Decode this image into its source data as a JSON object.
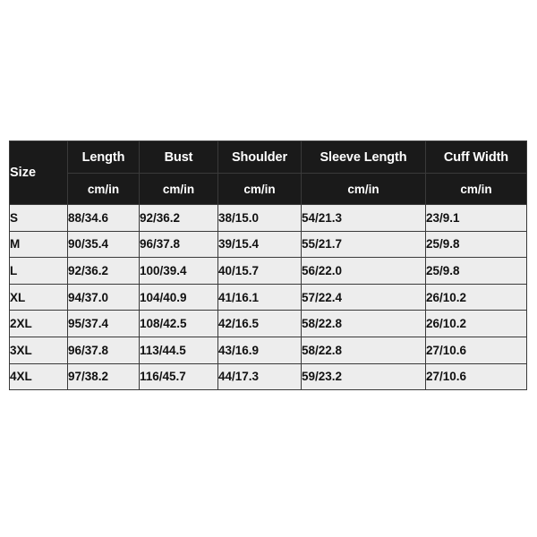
{
  "table": {
    "size_header_label": "Size",
    "unit_label": "cm/in",
    "columns": [
      {
        "key": "size",
        "label": "Size",
        "unit": ""
      },
      {
        "key": "length",
        "label": "Length",
        "unit": "cm/in"
      },
      {
        "key": "bust",
        "label": "Bust",
        "unit": "cm/in"
      },
      {
        "key": "shoulder",
        "label": "Shoulder",
        "unit": "cm/in"
      },
      {
        "key": "sleeve",
        "label": "Sleeve Length",
        "unit": "cm/in"
      },
      {
        "key": "cuff",
        "label": "Cuff Width",
        "unit": "cm/in"
      }
    ],
    "rows": [
      {
        "size": "S",
        "length": "88/34.6",
        "bust": "92/36.2",
        "shoulder": "38/15.0",
        "sleeve": "54/21.3",
        "cuff": "23/9.1"
      },
      {
        "size": "M",
        "length": "90/35.4",
        "bust": "96/37.8",
        "shoulder": "39/15.4",
        "sleeve": "55/21.7",
        "cuff": "25/9.8"
      },
      {
        "size": "L",
        "length": "92/36.2",
        "bust": "100/39.4",
        "shoulder": "40/15.7",
        "sleeve": "56/22.0",
        "cuff": "25/9.8"
      },
      {
        "size": "XL",
        "length": "94/37.0",
        "bust": "104/40.9",
        "shoulder": "41/16.1",
        "sleeve": "57/22.4",
        "cuff": "26/10.2"
      },
      {
        "size": "2XL",
        "length": "95/37.4",
        "bust": "108/42.5",
        "shoulder": "42/16.5",
        "sleeve": "58/22.8",
        "cuff": "26/10.2"
      },
      {
        "size": "3XL",
        "length": "96/37.8",
        "bust": "113/44.5",
        "shoulder": "43/16.9",
        "sleeve": "58/22.8",
        "cuff": "27/10.6"
      },
      {
        "size": "4XL",
        "length": "97/38.2",
        "bust": "116/45.7",
        "shoulder": "44/17.3",
        "sleeve": "59/23.2",
        "cuff": "27/10.6"
      }
    ]
  },
  "colors": {
    "header_background": "#1a1a1a",
    "header_text": "#ffffff",
    "cell_background": "#ededed",
    "cell_text": "#111111",
    "page_background": "#ffffff",
    "border": "#2f2f2f"
  }
}
